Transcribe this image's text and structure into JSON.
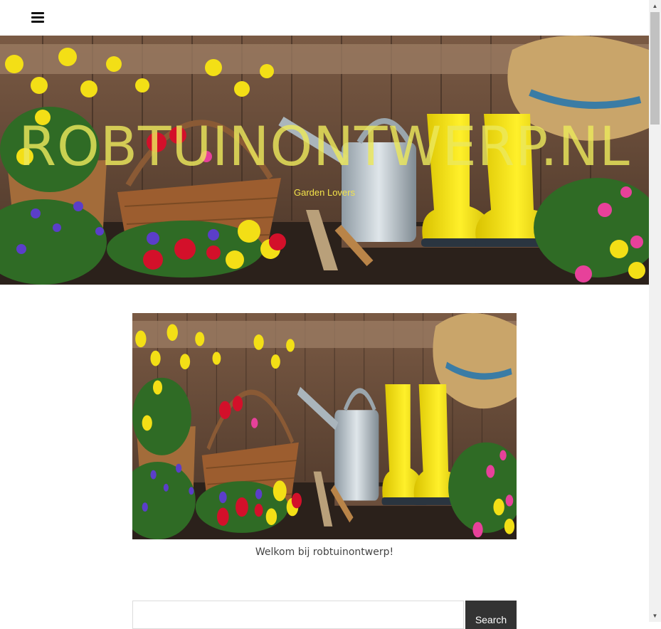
{
  "header": {
    "menu_icon": "hamburger-menu-icon"
  },
  "hero": {
    "site_title": "ROBTUINONTWERP.NL",
    "tagline": "Garden Lovers"
  },
  "content": {
    "image_caption": "Welkom bij robtuinontwerp!"
  },
  "search": {
    "placeholder": "",
    "button_label": "Search"
  },
  "scrollbar": {
    "up_icon": "scroll-up-arrow-icon",
    "down_icon": "scroll-down-arrow-icon",
    "up_glyph": "▲",
    "down_glyph": "▼"
  },
  "colors": {
    "title": "#ECE85C",
    "tagline": "#F3E34A",
    "search_button": "#333333",
    "caption": "#444444"
  }
}
